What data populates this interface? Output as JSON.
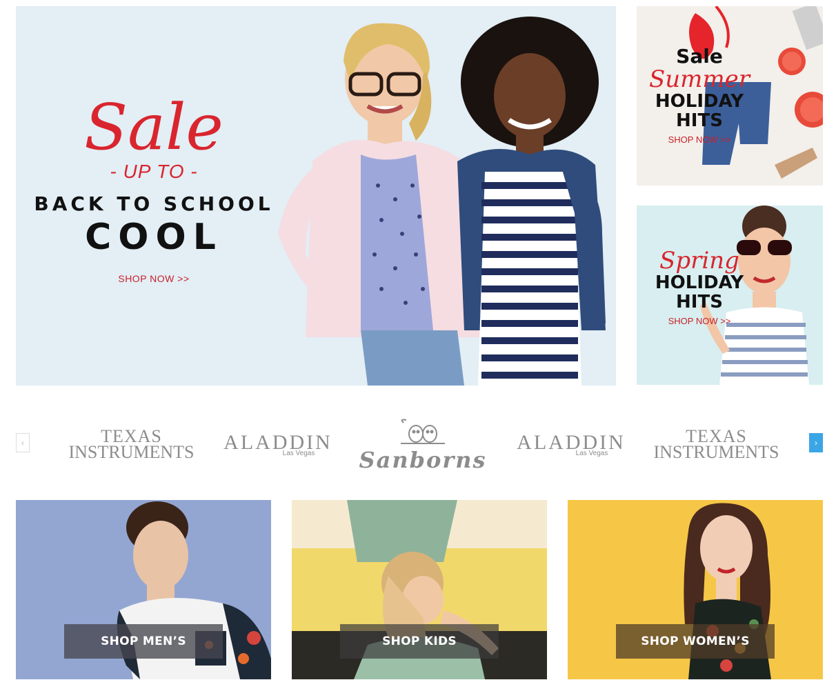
{
  "hero": {
    "sale": "Sale",
    "upto": "- UP TO -",
    "line1": "BACK TO SCHOOL",
    "line2": "COOL",
    "shop": "SHOP NOW >>",
    "image": "two-girls-back-to-school-photo"
  },
  "promos": [
    {
      "sale": "Sale",
      "script": "Summer",
      "line1": "HOLIDAY",
      "line2": "HITS",
      "shop": "SHOP NOW >>",
      "image": "swimwear-flatlay-photo"
    },
    {
      "script": "Spring",
      "line1": "HOLIDAY",
      "line2": "HITS",
      "shop": "SHOP NOW >>",
      "image": "woman-sunglasses-photo"
    }
  ],
  "brands": {
    "items": [
      {
        "name": "Texas Instruments",
        "l1": "TEXAS",
        "l2": "INSTRUMENTS"
      },
      {
        "name": "Aladdin",
        "l1": "ALADDIN",
        "l2": "Las Vegas"
      },
      {
        "name": "Sanborns",
        "l1": "Sanborns"
      },
      {
        "name": "Aladdin",
        "l1": "ALADDIN",
        "l2": "Las Vegas"
      },
      {
        "name": "Texas Instruments",
        "l1": "TEXAS",
        "l2": "INSTRUMENTS"
      }
    ],
    "prev_icon": "chevron-left-icon",
    "next_icon": "chevron-right-icon"
  },
  "categories": [
    {
      "label": "SHOP MEN’S",
      "image": "man-floral-tee-photo"
    },
    {
      "label": "SHOP KIDS",
      "image": "kids-on-yellow-car-photo"
    },
    {
      "label": "SHOP WOMEN’S",
      "image": "woman-floral-dress-photo"
    }
  ],
  "colors": {
    "accent_red": "#d9252e",
    "carousel_next": "#3aa6e6",
    "hero_bg": "#e3eef5",
    "men_bg": "#93a6d2",
    "women_bg": "#f6c746"
  }
}
